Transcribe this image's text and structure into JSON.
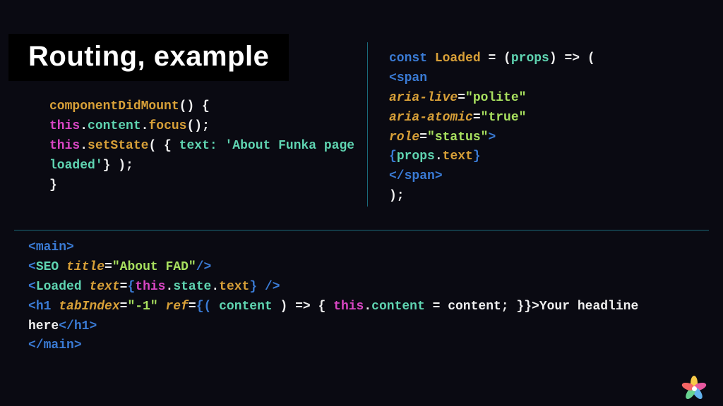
{
  "title": "Routing, example",
  "left": {
    "l1a": "componentDidMount",
    "l1b": "() {",
    "l2a": "this",
    "l2b": ".",
    "l2c": "content",
    "l2d": ".",
    "l2e": "focus",
    "l2f": "();",
    "l3a": "this",
    "l3b": ".",
    "l3c": "setState",
    "l3d": "( { ",
    "l3e": "text: 'About Funka page",
    "l4a": "loaded'",
    "l4b": "} );",
    "l5": "}"
  },
  "right": {
    "l1a": "const ",
    "l1b": "Loaded ",
    "l1c": "= (",
    "l1d": "props",
    "l1e": ") => (",
    "l2a": "<",
    "l2b": "span",
    "l3a": "aria-live",
    "l3b": "=",
    "l3c": "\"polite\"",
    "l4a": "aria-atomic",
    "l4b": "=",
    "l4c": "\"true\"",
    "l5a": "role",
    "l5b": "=",
    "l5c": "\"status\"",
    "l5d": ">",
    "l6a": "{",
    "l6b": "props",
    "l6c": ".",
    "l6d": "text",
    "l6e": "}",
    "l7a": "</",
    "l7b": "span",
    "l7c": ">",
    "l8": ");"
  },
  "bottom": {
    "l1a": "<",
    "l1b": "main",
    "l1c": ">",
    "l2a": "<",
    "l2b": "SEO ",
    "l2c": "title",
    "l2d": "=",
    "l2e": "\"About FAD\"",
    "l2f": "/>",
    "l3a": "<",
    "l3b": "Loaded ",
    "l3c": "text",
    "l3d": "=",
    "l3e": "{",
    "l3f": "this",
    "l3g": ".",
    "l3h": "state",
    "l3i": ".",
    "l3j": "text",
    "l3k": "} />",
    "l4a": "<",
    "l4b": "h1 ",
    "l4c": "tabIndex",
    "l4d": "=",
    "l4e": "\"-1\" ",
    "l4f": "ref",
    "l4g": "=",
    "l4h": "{( ",
    "l4i": "content ",
    "l4j": ") => { ",
    "l4k": "this",
    "l4l": ".",
    "l4m": "content ",
    "l4n": "= content; }}>",
    "l4o": "Your headline here",
    "l4p": "</",
    "l4q": "h1",
    "l4r": ">",
    "l5a": "</",
    "l5b": "main",
    "l5c": ">"
  }
}
